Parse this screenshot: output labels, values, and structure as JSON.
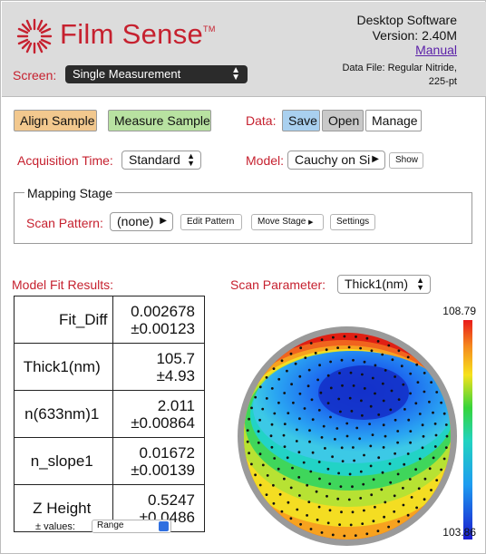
{
  "header": {
    "brand": "Film Sense",
    "trademark": "TM",
    "product": "Desktop Software",
    "version": "Version: 2.40M",
    "manual_link": "Manual",
    "data_file_line1": "Data File: Regular Nitride,",
    "data_file_line2": "225-pt",
    "screen_label": "Screen:",
    "screen_value": "Single Measurement"
  },
  "toolbar": {
    "align_label": "Align Sample",
    "measure_label": "Measure Sample",
    "data_label": "Data:",
    "save_label": "Save",
    "open_label": "Open",
    "manage_label": "Manage"
  },
  "acquisition": {
    "label": "Acquisition Time:",
    "value": "Standard"
  },
  "model": {
    "label": "Model:",
    "value": "Cauchy on Si",
    "show_label": "Show"
  },
  "mapping_stage": {
    "legend": "Mapping Stage",
    "scan_pattern_label": "Scan Pattern:",
    "scan_pattern_value": "(none)",
    "edit_pattern_label": "Edit Pattern",
    "move_stage_label": "Move Stage",
    "settings_label": "Settings"
  },
  "results": {
    "label": "Model Fit Results:",
    "rows": [
      {
        "name": "Fit_Diff",
        "value": "0.002678",
        "error": "±0.00123"
      },
      {
        "name": "Thick1(nm)",
        "value": "105.7",
        "error": "±4.93"
      },
      {
        "name": "n(633nm)1",
        "value": "2.011",
        "error": "±0.00864"
      },
      {
        "name": "n_slope1",
        "value": "0.01672",
        "error": "±0.00139"
      },
      {
        "name": "Z Height",
        "value": "0.5247",
        "error": "±0.0486"
      }
    ],
    "pm_label": "± values:",
    "pm_value": "Range"
  },
  "scan_parameter": {
    "label": "Scan Parameter:",
    "value": "Thick1(nm)",
    "colorbar_max": "108.79",
    "colorbar_min": "103.86"
  },
  "colors": {
    "brand_red": "#c6212f",
    "link_purple": "#5a1fa8",
    "align_orange": "#f2c88e",
    "measure_green": "#b8e2a1",
    "save_blue": "#a9d0ef",
    "header_gray": "#dcdcdc"
  },
  "icons": {
    "logo": "film-sense-logo-icon",
    "dropdown": "updown-arrows-icon",
    "menu_arrow": "triangle-right-icon"
  }
}
